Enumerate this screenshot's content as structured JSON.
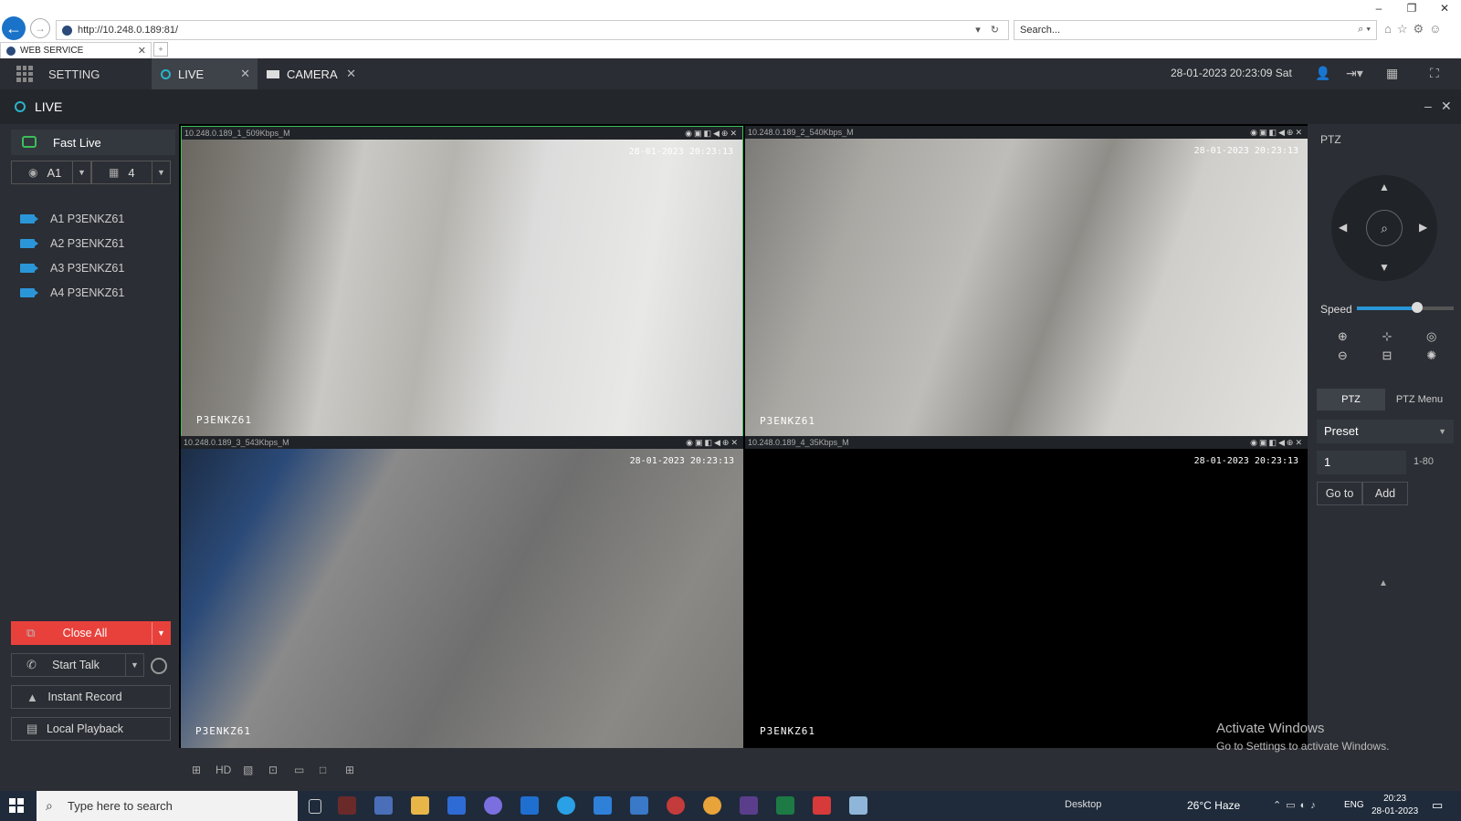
{
  "browser": {
    "url": "http://10.248.0.189:81/",
    "search_placeholder": "Search...",
    "tab_title": "WEB SERVICE",
    "win_min": "–",
    "win_max": "❐",
    "win_close": "✕"
  },
  "appbar": {
    "setting_label": "SETTING",
    "tabs": [
      {
        "label": "LIVE"
      },
      {
        "label": "CAMERA"
      }
    ],
    "datetime": "28-01-2023 20:23:09 Sat"
  },
  "live": {
    "title": "LIVE"
  },
  "left": {
    "fast_live": "Fast Live",
    "account_select": "A1",
    "split_select": "4",
    "cameras": [
      "A1 P3ENKZ61",
      "A2 P3ENKZ61",
      "A3 P3ENKZ61",
      "A4 P3ENKZ61"
    ],
    "close_all": "Close All",
    "start_talk": "Start Talk",
    "instant_record": "Instant Record",
    "local_playback": "Local Playback"
  },
  "video": {
    "panes": [
      {
        "header": "10.248.0.189_1_509Kbps_M",
        "timestamp": "28-01-2023 20:23:13",
        "name": "P3ENKZ61"
      },
      {
        "header": "10.248.0.189_2_540Kbps_M",
        "timestamp": "28-01-2023 20:23:13",
        "name": "P3ENKZ61"
      },
      {
        "header": "10.248.0.189_3_543Kbps_M",
        "timestamp": "28-01-2023 20:23:13",
        "name": "P3ENKZ61"
      },
      {
        "header": "10.248.0.189_4_35Kbps_M",
        "timestamp": "28-01-2023 20:23:13",
        "name": "P3ENKZ61"
      }
    ],
    "toolbar_hd": "HD"
  },
  "ptz": {
    "title": "PTZ",
    "speed_label": "Speed",
    "speed_level": 5,
    "speed_max": 8,
    "tab_ptz": "PTZ",
    "tab_menu": "PTZ Menu",
    "preset_label": "Preset",
    "preset_value": "1",
    "preset_range": "1-80",
    "goto_label": "Go to",
    "add_label": "Add"
  },
  "watermark": {
    "line1": "Activate Windows",
    "line2": "Go to Settings to activate Windows."
  },
  "taskbar": {
    "search_placeholder": "Type here to search",
    "desktop_label": "Desktop",
    "weather": "26°C  Haze",
    "lang": "ENG",
    "time": "20:23",
    "date": "28-01-2023"
  }
}
